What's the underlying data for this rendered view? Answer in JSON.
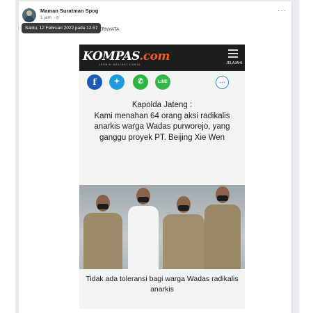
{
  "post": {
    "author": "Maman Suratman Spog",
    "time": "1 jam",
    "tooltip": "Sabtu, 12 Februari 2022 pada 12.57",
    "text": "... TERNYATA",
    "more_label": "···"
  },
  "article": {
    "logo_main": "KOMPAS",
    "logo_dot": ".com",
    "tagline": "JERNIH MELIHAT DUNIA",
    "menu_label": "JELAJAHI",
    "share_icons": [
      "facebook-icon",
      "twitter-icon",
      "whatsapp-icon",
      "line-icon",
      "comment-icon"
    ],
    "headline": "Kapolda Jateng :\nKami menahan 64 orang aksi radikalis anarkis warga Wadas purworejo, yang  ganggu proyek PT. Beijing Xie Wen",
    "caption": "Tidak ada toleransi bagi warga Wadas radikalis anarkis"
  },
  "colors": {
    "facebook": "#1b5bb8",
    "twitter": "#1d9ddb",
    "whatsapp": "#2db742",
    "line": "#38b54a",
    "kompas_orange": "#f15a22"
  }
}
